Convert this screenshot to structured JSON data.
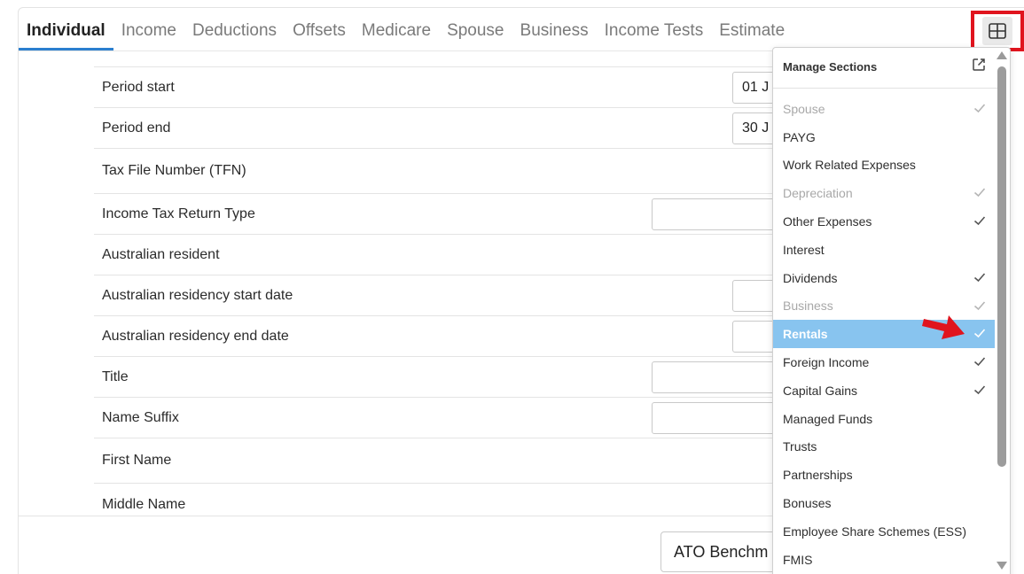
{
  "tabs": [
    {
      "label": "Individual",
      "active": true
    },
    {
      "label": "Income"
    },
    {
      "label": "Deductions"
    },
    {
      "label": "Offsets"
    },
    {
      "label": "Medicare"
    },
    {
      "label": "Spouse"
    },
    {
      "label": "Business"
    },
    {
      "label": "Income Tests"
    },
    {
      "label": "Estimate"
    }
  ],
  "form": {
    "rows": [
      {
        "label": "Period start",
        "value": "01 J"
      },
      {
        "label": "Period end",
        "value": "30 J"
      },
      {
        "label": "Tax File Number (TFN)"
      },
      {
        "label": "Income Tax Return Type",
        "value": ""
      },
      {
        "label": "Australian resident"
      },
      {
        "label": "Australian residency start date",
        "value": ""
      },
      {
        "label": "Australian residency end date",
        "value": ""
      },
      {
        "label": "Title",
        "value": ""
      },
      {
        "label": "Name Suffix",
        "value": ""
      },
      {
        "label": "First Name"
      },
      {
        "label": "Middle Name"
      }
    ]
  },
  "footer": {
    "ato_button": "ATO Benchm"
  },
  "manage_sections": {
    "title": "Manage Sections",
    "items": [
      {
        "label": "Spouse",
        "checked": true,
        "disabled": true
      },
      {
        "label": "PAYG",
        "checked": false
      },
      {
        "label": "Work Related Expenses",
        "checked": false
      },
      {
        "label": "Depreciation",
        "checked": true,
        "disabled": true
      },
      {
        "label": "Other Expenses",
        "checked": true
      },
      {
        "label": "Interest",
        "checked": false
      },
      {
        "label": "Dividends",
        "checked": true
      },
      {
        "label": "Business",
        "checked": true,
        "disabled": true
      },
      {
        "label": "Rentals",
        "checked": true,
        "selected": true
      },
      {
        "label": "Foreign Income",
        "checked": true
      },
      {
        "label": "Capital Gains",
        "checked": true
      },
      {
        "label": "Managed Funds",
        "checked": false
      },
      {
        "label": "Trusts",
        "checked": false
      },
      {
        "label": "Partnerships",
        "checked": false
      },
      {
        "label": "Bonuses",
        "checked": false
      },
      {
        "label": "Employee Share Schemes (ESS)",
        "checked": false
      },
      {
        "label": "FMIS",
        "checked": false
      }
    ]
  },
  "colors": {
    "accent_tab": "#2b7fcf",
    "selected_item": "#88c4ef",
    "highlight_box": "#e0141e",
    "annotation_arrow": "#e0141e"
  },
  "icons": {
    "layout_button": "grid-layout-icon",
    "external": "external-link-icon",
    "check": "check-icon",
    "annotation": "red-arrow-icon"
  }
}
